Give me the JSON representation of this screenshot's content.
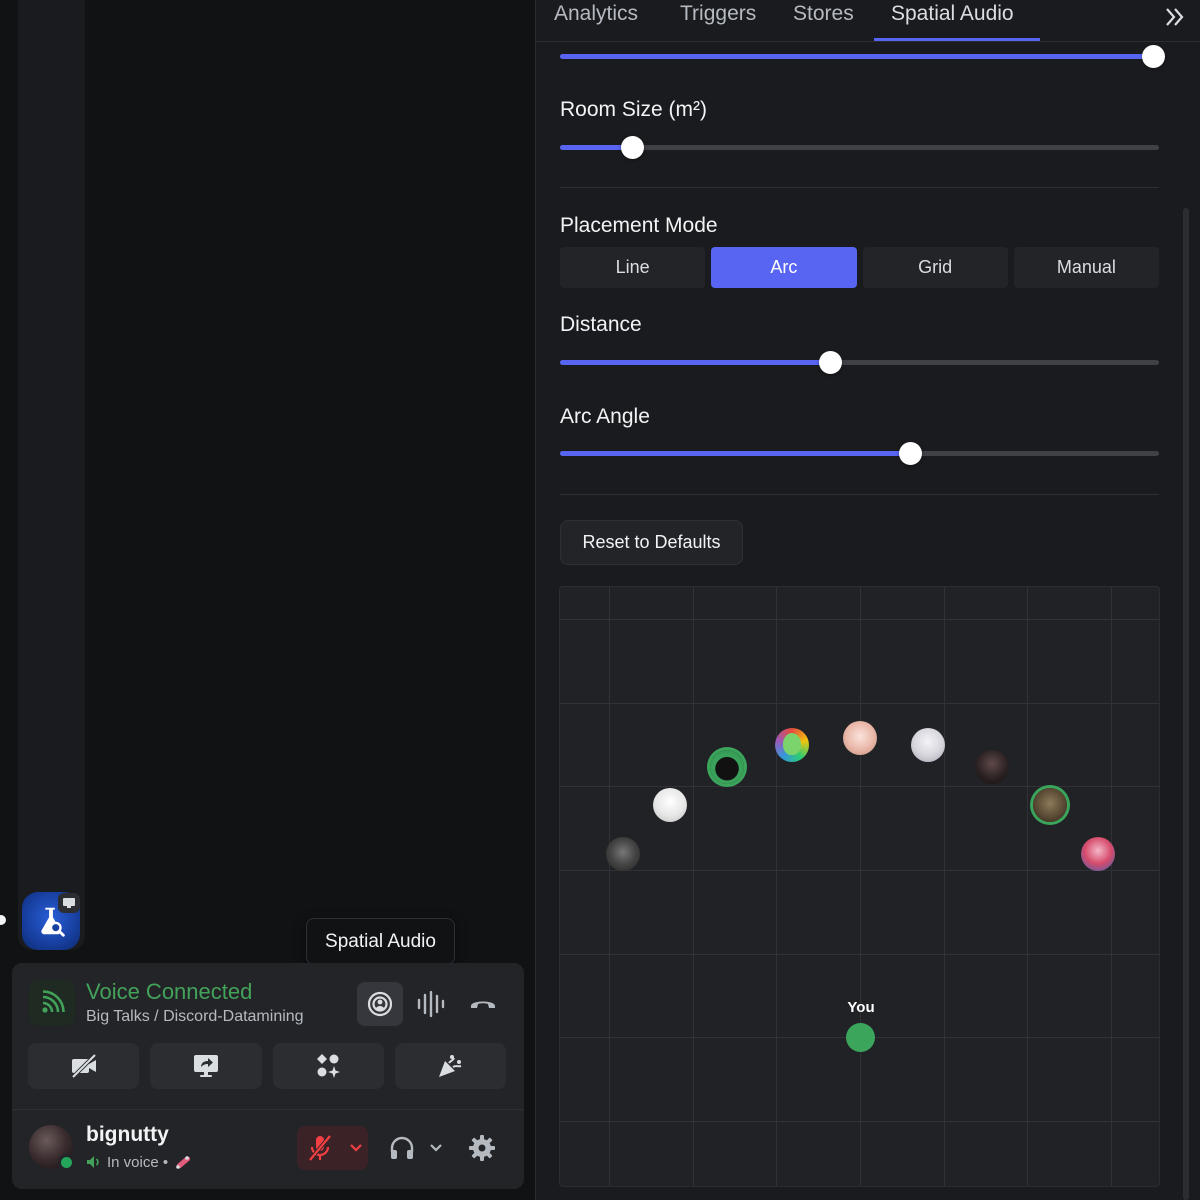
{
  "tabs": {
    "items": [
      "Analytics",
      "Triggers",
      "Stores",
      "Spatial Audio"
    ],
    "active": "Spatial Audio",
    "more_icon": "chevron-double-right-icon"
  },
  "spatial": {
    "top_slider_value": 0.99,
    "room_size": {
      "label": "Room Size (m²)",
      "value": 0.12
    },
    "placement_mode": {
      "label": "Placement Mode",
      "options": [
        "Line",
        "Arc",
        "Grid",
        "Manual"
      ],
      "selected": "Arc"
    },
    "distance": {
      "label": "Distance",
      "value": 0.45
    },
    "arc_angle": {
      "label": "Arc Angle",
      "value": 0.585
    },
    "reset_label": "Reset to Defaults",
    "you_label": "You"
  },
  "tooltip": {
    "text": "Spatial Audio"
  },
  "voice": {
    "status": "Voice Connected",
    "channel": "Big Talks / Discord-Datamining",
    "status_color": "#43a25a"
  },
  "user": {
    "name": "bignutty",
    "activity": "In voice •"
  },
  "colors": {
    "accent": "#5865f2",
    "online": "#23a55a"
  }
}
